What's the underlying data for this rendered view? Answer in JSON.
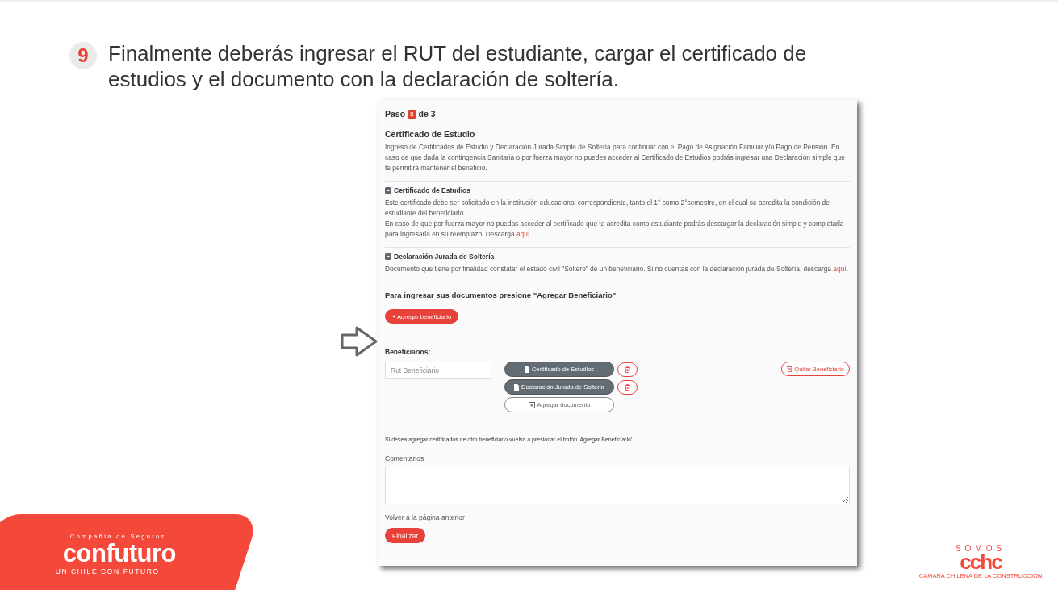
{
  "instruction": {
    "number": "9",
    "text": "Finalmente deberás ingresar el RUT del estudiante, cargar el certificado de estudios y el documento con la declaración de soltería."
  },
  "form": {
    "step": {
      "prefix": "Paso",
      "current": "3",
      "suffix": "de 3"
    },
    "title": "Certificado de Estudio",
    "intro": "Ingreso de Certificados de Estudio y Declaración Jurada Simple de Soltería para continuar con el Pago de Asignación Familiar y/o Pago de Pensión. En caso de que dada la contingencia Sanitaria o por fuerza mayor no puedes acceder al Certificado de Estudios podrás ingresar una Declaración simple que te permitirá mantener el beneficio.",
    "sections": [
      {
        "title": "Certificado de Estudios",
        "paragraphs": [
          {
            "text": "Este certificado debe ser solicitado en la institución educacional correspondiente, tanto el 1° como 2°semestre, en el cual se acredita la condición de estudiante del beneficiario."
          },
          {
            "text": "En caso de que por fuerza mayor no puedas acceder al certificado que te acredita como estudiante podrás descargar la declaración simple y completarla para ingresarla en su reemplazo. Descarga",
            "link": "aquí",
            "tail": " ."
          }
        ]
      },
      {
        "title": "Declaración Jurada de Soltería",
        "paragraphs": [
          {
            "text": "Documento que tiene por finalidad constatar el estado civil \"Soltero\" de un beneficiario. Si no cuentas con la declaración jurada de Soltería, descarga",
            "link": "aquí",
            "tail": "."
          }
        ]
      }
    ],
    "prompt": "Para ingresar sus documentos presione \"Agregar Beneficiario\"",
    "add_button": "+ Agregar beneficiario",
    "beneficiaries_label": "Beneficiarios:",
    "beneficiary": {
      "rut_placeholder": "Rut Beneficiario",
      "documents": [
        {
          "label": "Certificado de Estudios"
        },
        {
          "label": "Declaración Jurada de Soltería"
        }
      ],
      "add_document": "Agregar documento",
      "remove": "Quitar Beneficiario"
    },
    "note": "Si desea agregar certificados de otro beneficiario vuelva a presionar el botón 'Agregar Beneficiario'",
    "comments_label": "Comentarios",
    "back_link": "Volver a la página anterior",
    "submit": "Finalizar"
  },
  "logos": {
    "confuturo": {
      "kicker": "Compañía de Seguros",
      "name": "confuturo",
      "tagline": "UN CHILE CON FUTURO"
    },
    "cchc": {
      "kicker": "SOMOS",
      "name": "cchc",
      "subtitle": "CÁMARA CHILENA DE LA CONSTRUCCIÓN"
    }
  }
}
